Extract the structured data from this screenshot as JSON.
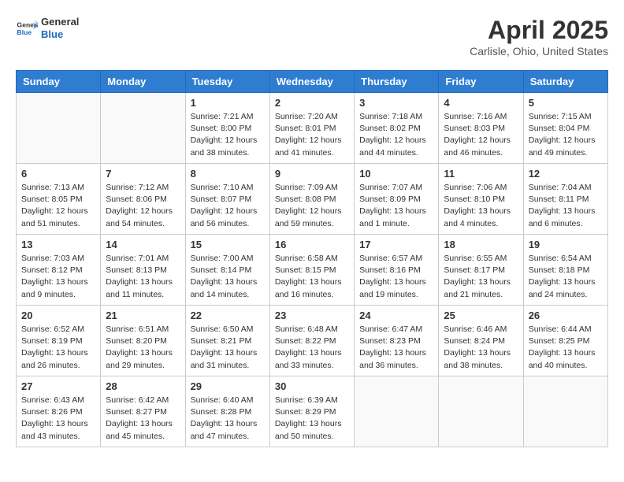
{
  "logo": {
    "line1": "General",
    "line2": "Blue"
  },
  "title": "April 2025",
  "subtitle": "Carlisle, Ohio, United States",
  "weekdays": [
    "Sunday",
    "Monday",
    "Tuesday",
    "Wednesday",
    "Thursday",
    "Friday",
    "Saturday"
  ],
  "weeks": [
    [
      {
        "day": "",
        "info": ""
      },
      {
        "day": "",
        "info": ""
      },
      {
        "day": "1",
        "info": "Sunrise: 7:21 AM\nSunset: 8:00 PM\nDaylight: 12 hours and 38 minutes."
      },
      {
        "day": "2",
        "info": "Sunrise: 7:20 AM\nSunset: 8:01 PM\nDaylight: 12 hours and 41 minutes."
      },
      {
        "day": "3",
        "info": "Sunrise: 7:18 AM\nSunset: 8:02 PM\nDaylight: 12 hours and 44 minutes."
      },
      {
        "day": "4",
        "info": "Sunrise: 7:16 AM\nSunset: 8:03 PM\nDaylight: 12 hours and 46 minutes."
      },
      {
        "day": "5",
        "info": "Sunrise: 7:15 AM\nSunset: 8:04 PM\nDaylight: 12 hours and 49 minutes."
      }
    ],
    [
      {
        "day": "6",
        "info": "Sunrise: 7:13 AM\nSunset: 8:05 PM\nDaylight: 12 hours and 51 minutes."
      },
      {
        "day": "7",
        "info": "Sunrise: 7:12 AM\nSunset: 8:06 PM\nDaylight: 12 hours and 54 minutes."
      },
      {
        "day": "8",
        "info": "Sunrise: 7:10 AM\nSunset: 8:07 PM\nDaylight: 12 hours and 56 minutes."
      },
      {
        "day": "9",
        "info": "Sunrise: 7:09 AM\nSunset: 8:08 PM\nDaylight: 12 hours and 59 minutes."
      },
      {
        "day": "10",
        "info": "Sunrise: 7:07 AM\nSunset: 8:09 PM\nDaylight: 13 hours and 1 minute."
      },
      {
        "day": "11",
        "info": "Sunrise: 7:06 AM\nSunset: 8:10 PM\nDaylight: 13 hours and 4 minutes."
      },
      {
        "day": "12",
        "info": "Sunrise: 7:04 AM\nSunset: 8:11 PM\nDaylight: 13 hours and 6 minutes."
      }
    ],
    [
      {
        "day": "13",
        "info": "Sunrise: 7:03 AM\nSunset: 8:12 PM\nDaylight: 13 hours and 9 minutes."
      },
      {
        "day": "14",
        "info": "Sunrise: 7:01 AM\nSunset: 8:13 PM\nDaylight: 13 hours and 11 minutes."
      },
      {
        "day": "15",
        "info": "Sunrise: 7:00 AM\nSunset: 8:14 PM\nDaylight: 13 hours and 14 minutes."
      },
      {
        "day": "16",
        "info": "Sunrise: 6:58 AM\nSunset: 8:15 PM\nDaylight: 13 hours and 16 minutes."
      },
      {
        "day": "17",
        "info": "Sunrise: 6:57 AM\nSunset: 8:16 PM\nDaylight: 13 hours and 19 minutes."
      },
      {
        "day": "18",
        "info": "Sunrise: 6:55 AM\nSunset: 8:17 PM\nDaylight: 13 hours and 21 minutes."
      },
      {
        "day": "19",
        "info": "Sunrise: 6:54 AM\nSunset: 8:18 PM\nDaylight: 13 hours and 24 minutes."
      }
    ],
    [
      {
        "day": "20",
        "info": "Sunrise: 6:52 AM\nSunset: 8:19 PM\nDaylight: 13 hours and 26 minutes."
      },
      {
        "day": "21",
        "info": "Sunrise: 6:51 AM\nSunset: 8:20 PM\nDaylight: 13 hours and 29 minutes."
      },
      {
        "day": "22",
        "info": "Sunrise: 6:50 AM\nSunset: 8:21 PM\nDaylight: 13 hours and 31 minutes."
      },
      {
        "day": "23",
        "info": "Sunrise: 6:48 AM\nSunset: 8:22 PM\nDaylight: 13 hours and 33 minutes."
      },
      {
        "day": "24",
        "info": "Sunrise: 6:47 AM\nSunset: 8:23 PM\nDaylight: 13 hours and 36 minutes."
      },
      {
        "day": "25",
        "info": "Sunrise: 6:46 AM\nSunset: 8:24 PM\nDaylight: 13 hours and 38 minutes."
      },
      {
        "day": "26",
        "info": "Sunrise: 6:44 AM\nSunset: 8:25 PM\nDaylight: 13 hours and 40 minutes."
      }
    ],
    [
      {
        "day": "27",
        "info": "Sunrise: 6:43 AM\nSunset: 8:26 PM\nDaylight: 13 hours and 43 minutes."
      },
      {
        "day": "28",
        "info": "Sunrise: 6:42 AM\nSunset: 8:27 PM\nDaylight: 13 hours and 45 minutes."
      },
      {
        "day": "29",
        "info": "Sunrise: 6:40 AM\nSunset: 8:28 PM\nDaylight: 13 hours and 47 minutes."
      },
      {
        "day": "30",
        "info": "Sunrise: 6:39 AM\nSunset: 8:29 PM\nDaylight: 13 hours and 50 minutes."
      },
      {
        "day": "",
        "info": ""
      },
      {
        "day": "",
        "info": ""
      },
      {
        "day": "",
        "info": ""
      }
    ]
  ]
}
